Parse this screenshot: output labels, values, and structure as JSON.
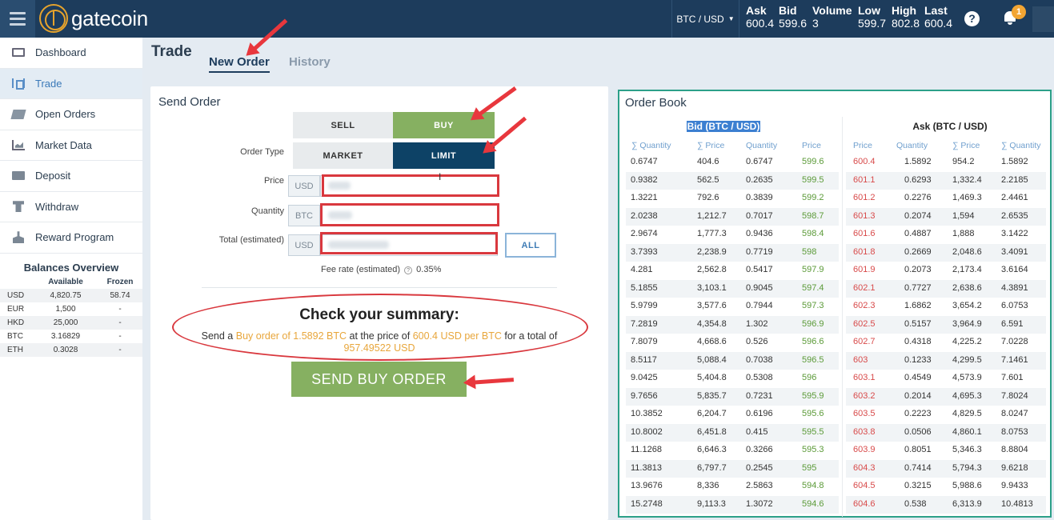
{
  "brand": {
    "name": "gatecoin"
  },
  "header": {
    "pair": "BTC / USD",
    "stats": [
      {
        "label": "Ask",
        "value": "600.4"
      },
      {
        "label": "Bid",
        "value": "599.6"
      },
      {
        "label": "Volume",
        "value": "3"
      },
      {
        "label": "Low",
        "value": "599.7"
      },
      {
        "label": "High",
        "value": "802.8"
      },
      {
        "label": "Last",
        "value": "600.4"
      }
    ],
    "help_glyph": "?",
    "notification_count": "1"
  },
  "sidebar": {
    "items": [
      {
        "label": "Dashboard",
        "icon": "monitor-icon"
      },
      {
        "label": "Trade",
        "icon": "trade-icon"
      },
      {
        "label": "Open Orders",
        "icon": "orders-icon"
      },
      {
        "label": "Market Data",
        "icon": "chart-icon"
      },
      {
        "label": "Deposit",
        "icon": "deposit-icon"
      },
      {
        "label": "Withdraw",
        "icon": "withdraw-icon"
      },
      {
        "label": "Reward Program",
        "icon": "reward-icon"
      }
    ],
    "active_index": 1
  },
  "balances": {
    "title": "Balances Overview",
    "headers": [
      "",
      "Available",
      "Frozen"
    ],
    "rows": [
      [
        "USD",
        "4,820.75",
        "58.74"
      ],
      [
        "EUR",
        "1,500",
        "-"
      ],
      [
        "HKD",
        "25,000",
        "-"
      ],
      [
        "BTC",
        "3.16829",
        "-"
      ],
      [
        "ETH",
        "0.3028",
        "-"
      ]
    ]
  },
  "page": {
    "title": "Trade",
    "tabs": [
      "New Order",
      "History"
    ],
    "active_tab": "New Order"
  },
  "send_order": {
    "title": "Send Order",
    "side_options": [
      "SELL",
      "BUY"
    ],
    "selected_side": "BUY",
    "order_type_label": "Order Type",
    "type_options": [
      "MARKET",
      "LIMIT"
    ],
    "selected_type": "LIMIT",
    "price_label": "Price",
    "price_currency": "USD",
    "quantity_label": "Quantity",
    "quantity_currency": "BTC",
    "total_label": "Total (estimated)",
    "total_currency": "USD",
    "all_button": "ALL",
    "fee_label": "Fee rate (estimated)",
    "fee_value": "0.35%",
    "summary_title": "Check your summary:",
    "summary_parts": {
      "p1": "Send a ",
      "side": "Buy order of 1.5892 BTC",
      "p2": " at the price of ",
      "price": "600.4 USD per BTC",
      "p3": " for a total of ",
      "total": "957.49522 USD"
    },
    "submit_label": "SEND BUY ORDER"
  },
  "order_book": {
    "title": "Order Book",
    "bid_header": "Bid (BTC / USD)",
    "ask_header": "Ask (BTC / USD)",
    "bid_columns": [
      "∑ Quantity",
      "∑ Price",
      "Quantity",
      "Price"
    ],
    "ask_columns": [
      "Price",
      "Quantity",
      "∑ Price",
      "∑ Quantity"
    ],
    "bids": [
      [
        "0.6747",
        "404.6",
        "0.6747",
        "599.6"
      ],
      [
        "0.9382",
        "562.5",
        "0.2635",
        "599.5"
      ],
      [
        "1.3221",
        "792.6",
        "0.3839",
        "599.2"
      ],
      [
        "2.0238",
        "1,212.7",
        "0.7017",
        "598.7"
      ],
      [
        "2.9674",
        "1,777.3",
        "0.9436",
        "598.4"
      ],
      [
        "3.7393",
        "2,238.9",
        "0.7719",
        "598"
      ],
      [
        "4.281",
        "2,562.8",
        "0.5417",
        "597.9"
      ],
      [
        "5.1855",
        "3,103.1",
        "0.9045",
        "597.4"
      ],
      [
        "5.9799",
        "3,577.6",
        "0.7944",
        "597.3"
      ],
      [
        "7.2819",
        "4,354.8",
        "1.302",
        "596.9"
      ],
      [
        "7.8079",
        "4,668.6",
        "0.526",
        "596.6"
      ],
      [
        "8.5117",
        "5,088.4",
        "0.7038",
        "596.5"
      ],
      [
        "9.0425",
        "5,404.8",
        "0.5308",
        "596"
      ],
      [
        "9.7656",
        "5,835.7",
        "0.7231",
        "595.9"
      ],
      [
        "10.3852",
        "6,204.7",
        "0.6196",
        "595.6"
      ],
      [
        "10.8002",
        "6,451.8",
        "0.415",
        "595.5"
      ],
      [
        "11.1268",
        "6,646.3",
        "0.3266",
        "595.3"
      ],
      [
        "11.3813",
        "6,797.7",
        "0.2545",
        "595"
      ],
      [
        "13.9676",
        "8,336",
        "2.5863",
        "594.8"
      ],
      [
        "15.2748",
        "9,113.3",
        "1.3072",
        "594.6"
      ]
    ],
    "asks": [
      [
        "600.4",
        "1.5892",
        "954.2",
        "1.5892"
      ],
      [
        "601.1",
        "0.6293",
        "1,332.4",
        "2.2185"
      ],
      [
        "601.2",
        "0.2276",
        "1,469.3",
        "2.4461"
      ],
      [
        "601.3",
        "0.2074",
        "1,594",
        "2.6535"
      ],
      [
        "601.6",
        "0.4887",
        "1,888",
        "3.1422"
      ],
      [
        "601.8",
        "0.2669",
        "2,048.6",
        "3.4091"
      ],
      [
        "601.9",
        "0.2073",
        "2,173.4",
        "3.6164"
      ],
      [
        "602.1",
        "0.7727",
        "2,638.6",
        "4.3891"
      ],
      [
        "602.3",
        "1.6862",
        "3,654.2",
        "6.0753"
      ],
      [
        "602.5",
        "0.5157",
        "3,964.9",
        "6.591"
      ],
      [
        "602.7",
        "0.4318",
        "4,225.2",
        "7.0228"
      ],
      [
        "603",
        "0.1233",
        "4,299.5",
        "7.1461"
      ],
      [
        "603.1",
        "0.4549",
        "4,573.9",
        "7.601"
      ],
      [
        "603.2",
        "0.2014",
        "4,695.3",
        "7.8024"
      ],
      [
        "603.5",
        "0.2223",
        "4,829.5",
        "8.0247"
      ],
      [
        "603.8",
        "0.0506",
        "4,860.1",
        "8.0753"
      ],
      [
        "603.9",
        "0.8051",
        "5,346.3",
        "8.8804"
      ],
      [
        "604.3",
        "0.7414",
        "5,794.3",
        "9.6218"
      ],
      [
        "604.5",
        "0.3215",
        "5,988.6",
        "9.9433"
      ],
      [
        "604.6",
        "0.538",
        "6,313.9",
        "10.4813"
      ]
    ]
  },
  "colors": {
    "header_bg": "#1d3c5c",
    "buy_green": "#86b061",
    "limit_navy": "#0d4266",
    "annotation_red": "#e8373d",
    "book_border": "#2ca089",
    "ask_red": "#d84a4a",
    "bid_green": "#5b9a38",
    "highlight_orange": "#e8a63b"
  }
}
